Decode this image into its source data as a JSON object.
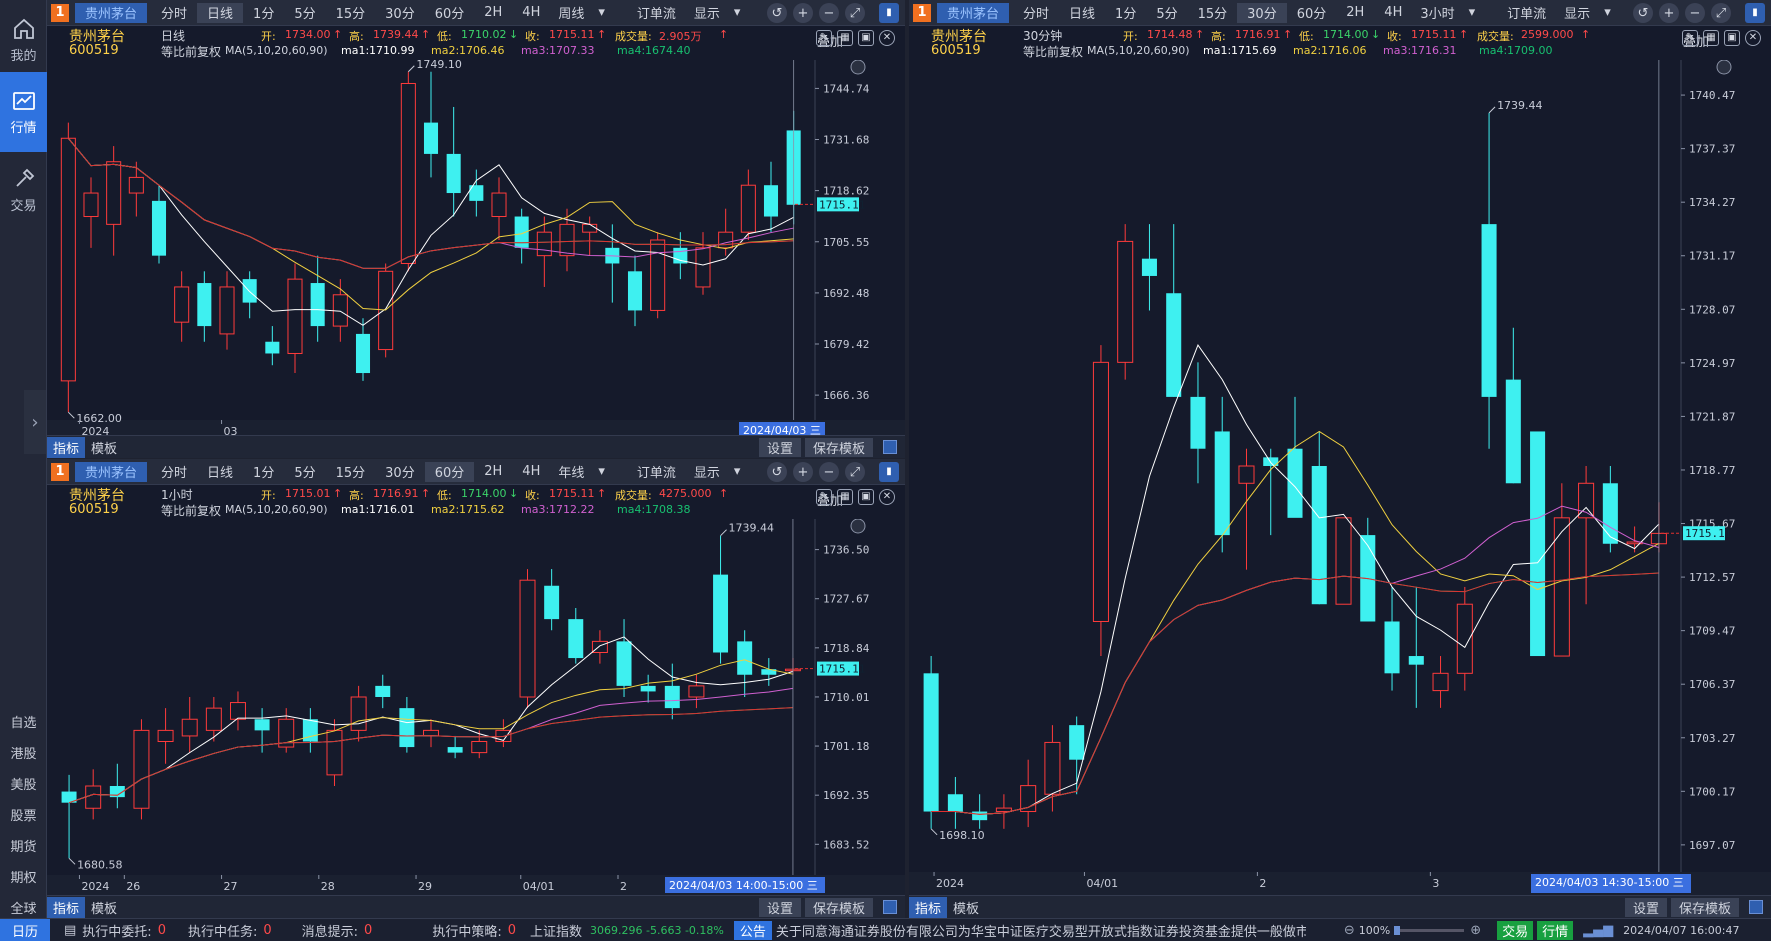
{
  "sidebar": {
    "nav": [
      {
        "label": "我的",
        "icon": "home-icon"
      },
      {
        "label": "行情",
        "icon": "chart-icon",
        "active": true
      },
      {
        "label": "交易",
        "icon": "trade-icon"
      }
    ],
    "markets": [
      "自选",
      "港股",
      "美股",
      "股票",
      "期货",
      "期权",
      "全球"
    ]
  },
  "panels": {
    "daily": {
      "number": "1",
      "stock_name": "贵州茅台",
      "stock_code": "600519",
      "tabs": [
        "分时",
        "日线",
        "1分",
        "5分",
        "15分",
        "30分",
        "60分",
        "2H",
        "4H"
      ],
      "selected_tab": "日线",
      "period_dropdown": "周线",
      "order_flow": "订单流",
      "display": "显示",
      "period_label": "日线",
      "adjust_label": "等比前复权",
      "quote": {
        "open_label": "开:",
        "open": "1734.00",
        "high_label": "高:",
        "high": "1739.44",
        "low_label": "低:",
        "low": "1710.02",
        "close_label": "收:",
        "close": "1715.11",
        "vol_label": "成交量:",
        "vol": "2.905万"
      },
      "ma": {
        "params": "MA(5,10,20,60,90)",
        "ma1": "1710.99",
        "ma2": "1706.46",
        "ma3": "1707.33",
        "ma4": "1674.40"
      },
      "overlay": "叠加",
      "x_labels": [
        "2024",
        "03"
      ],
      "date_tag": "2024/04/03 三",
      "bottom_tabs": [
        "指标",
        "模板"
      ],
      "settings": "设置",
      "save_template": "保存模板"
    },
    "hourly": {
      "number": "1",
      "stock_name": "贵州茅台",
      "stock_code": "600519",
      "tabs": [
        "分时",
        "日线",
        "1分",
        "5分",
        "15分",
        "30分",
        "60分",
        "2H",
        "4H"
      ],
      "selected_tab": "60分",
      "period_dropdown": "年线",
      "order_flow": "订单流",
      "display": "显示",
      "period_label": "1小时",
      "adjust_label": "等比前复权",
      "quote": {
        "open_label": "开:",
        "open": "1715.01",
        "high_label": "高:",
        "high": "1716.91",
        "low_label": "低:",
        "low": "1714.00",
        "close_label": "收:",
        "close": "1715.11",
        "vol_label": "成交量:",
        "vol": "4275.000"
      },
      "ma": {
        "params": "MA(5,10,20,60,90)",
        "ma1": "1716.01",
        "ma2": "1715.62",
        "ma3": "1712.22",
        "ma4": "1708.38"
      },
      "overlay": "叠加",
      "x_labels": [
        "2024",
        "26",
        "27",
        "28",
        "29",
        "04/01",
        "2"
      ],
      "date_tag": "2024/04/03 14:00-15:00 三",
      "bottom_tabs": [
        "指标",
        "模板"
      ],
      "settings": "设置",
      "save_template": "保存模板"
    },
    "min30": {
      "number": "1",
      "stock_name": "贵州茅台",
      "stock_code": "600519",
      "tabs": [
        "分时",
        "日线",
        "1分",
        "5分",
        "15分",
        "30分",
        "60分",
        "2H",
        "4H"
      ],
      "selected_tab": "30分",
      "period_dropdown": "3小时",
      "order_flow": "订单流",
      "display": "显示",
      "period_label": "30分钟",
      "adjust_label": "等比前复权",
      "quote": {
        "open_label": "开:",
        "open": "1714.48",
        "high_label": "高:",
        "high": "1716.91",
        "low_label": "低:",
        "low": "1714.00",
        "close_label": "收:",
        "close": "1715.11",
        "vol_label": "成交量:",
        "vol": "2599.000"
      },
      "ma": {
        "params": "MA(5,10,20,60,90)",
        "ma1": "1715.69",
        "ma2": "1716.06",
        "ma3": "1716.31",
        "ma4": "1709.00"
      },
      "overlay": "叠加",
      "x_labels": [
        "2024",
        "04/01",
        "2",
        "3"
      ],
      "date_tag": "2024/04/03 14:30-15:00 三",
      "bottom_tabs": [
        "指标",
        "模板"
      ],
      "settings": "设置",
      "save_template": "保存模板"
    }
  },
  "chart_data": [
    {
      "type": "candlestick",
      "title": "贵州茅台 日线",
      "y_ticks": [
        "1744.74",
        "1731.68",
        "1718.62",
        "1705.55",
        "1692.48",
        "1679.42",
        "1666.36"
      ],
      "ylim": [
        1660,
        1752
      ],
      "last_price": "1715.11",
      "annotations": {
        "high": "1749.10",
        "low": "1662.00"
      },
      "candles": [
        {
          "o": 1670,
          "h": 1736,
          "l": 1662,
          "c": 1732
        },
        {
          "o": 1712,
          "h": 1722,
          "l": 1704,
          "c": 1718
        },
        {
          "o": 1710,
          "h": 1730,
          "l": 1702,
          "c": 1726
        },
        {
          "o": 1718,
          "h": 1726,
          "l": 1712,
          "c": 1722
        },
        {
          "o": 1716,
          "h": 1720,
          "l": 1700,
          "c": 1702
        },
        {
          "o": 1685,
          "h": 1698,
          "l": 1680,
          "c": 1694
        },
        {
          "o": 1695,
          "h": 1698,
          "l": 1680,
          "c": 1684
        },
        {
          "o": 1682,
          "h": 1698,
          "l": 1678,
          "c": 1694
        },
        {
          "o": 1696,
          "h": 1698,
          "l": 1686,
          "c": 1690
        },
        {
          "o": 1680,
          "h": 1684,
          "l": 1674,
          "c": 1677
        },
        {
          "o": 1677,
          "h": 1700,
          "l": 1672,
          "c": 1696
        },
        {
          "o": 1695,
          "h": 1702,
          "l": 1680,
          "c": 1684
        },
        {
          "o": 1684,
          "h": 1696,
          "l": 1680,
          "c": 1692
        },
        {
          "o": 1682,
          "h": 1686,
          "l": 1670,
          "c": 1672
        },
        {
          "o": 1678,
          "h": 1700,
          "l": 1676,
          "c": 1698
        },
        {
          "o": 1700,
          "h": 1749,
          "l": 1698,
          "c": 1746
        },
        {
          "o": 1736,
          "h": 1749,
          "l": 1722,
          "c": 1728
        },
        {
          "o": 1728,
          "h": 1740,
          "l": 1712,
          "c": 1718
        },
        {
          "o": 1720,
          "h": 1724,
          "l": 1712,
          "c": 1716
        },
        {
          "o": 1712,
          "h": 1722,
          "l": 1706,
          "c": 1718
        },
        {
          "o": 1712,
          "h": 1714,
          "l": 1700,
          "c": 1704
        },
        {
          "o": 1702,
          "h": 1712,
          "l": 1694,
          "c": 1708
        },
        {
          "o": 1702,
          "h": 1714,
          "l": 1698,
          "c": 1710
        },
        {
          "o": 1708,
          "h": 1712,
          "l": 1702,
          "c": 1710
        },
        {
          "o": 1704,
          "h": 1710,
          "l": 1690,
          "c": 1700
        },
        {
          "o": 1698,
          "h": 1702,
          "l": 1684,
          "c": 1688
        },
        {
          "o": 1688,
          "h": 1708,
          "l": 1686,
          "c": 1706
        },
        {
          "o": 1704,
          "h": 1708,
          "l": 1696,
          "c": 1700
        },
        {
          "o": 1694,
          "h": 1708,
          "l": 1692,
          "c": 1704
        },
        {
          "o": 1704,
          "h": 1714,
          "l": 1702,
          "c": 1708
        },
        {
          "o": 1708,
          "h": 1724,
          "l": 1706,
          "c": 1720
        },
        {
          "o": 1720,
          "h": 1726,
          "l": 1708,
          "c": 1712
        },
        {
          "o": 1734,
          "h": 1739,
          "l": 1710,
          "c": 1715
        }
      ]
    },
    {
      "type": "candlestick",
      "title": "贵州茅台 1小时",
      "y_ticks": [
        "1736.50",
        "1727.67",
        "1718.84",
        "1710.01",
        "1701.18",
        "1692.35",
        "1683.52"
      ],
      "ylim": [
        1678,
        1742
      ],
      "last_price": "1715.11",
      "annotations": {
        "high": "1739.44",
        "low": "1680.58"
      },
      "candles": [
        {
          "o": 1693,
          "h": 1696,
          "l": 1681,
          "c": 1691
        },
        {
          "o": 1690,
          "h": 1697,
          "l": 1688,
          "c": 1694
        },
        {
          "o": 1694,
          "h": 1698,
          "l": 1690,
          "c": 1692
        },
        {
          "o": 1690,
          "h": 1706,
          "l": 1688,
          "c": 1704
        },
        {
          "o": 1702,
          "h": 1708,
          "l": 1698,
          "c": 1704
        },
        {
          "o": 1703,
          "h": 1710,
          "l": 1700,
          "c": 1706
        },
        {
          "o": 1704,
          "h": 1710,
          "l": 1702,
          "c": 1708
        },
        {
          "o": 1706,
          "h": 1711,
          "l": 1704,
          "c": 1709
        },
        {
          "o": 1706,
          "h": 1708,
          "l": 1700,
          "c": 1704
        },
        {
          "o": 1701,
          "h": 1708,
          "l": 1700,
          "c": 1706
        },
        {
          "o": 1706,
          "h": 1708,
          "l": 1700,
          "c": 1702
        },
        {
          "o": 1696,
          "h": 1706,
          "l": 1694,
          "c": 1704
        },
        {
          "o": 1704,
          "h": 1712,
          "l": 1702,
          "c": 1710
        },
        {
          "o": 1712,
          "h": 1714,
          "l": 1708,
          "c": 1710
        },
        {
          "o": 1708,
          "h": 1710,
          "l": 1700,
          "c": 1701
        },
        {
          "o": 1703,
          "h": 1706,
          "l": 1701,
          "c": 1704
        },
        {
          "o": 1701,
          "h": 1703,
          "l": 1699,
          "c": 1700
        },
        {
          "o": 1700,
          "h": 1704,
          "l": 1699,
          "c": 1702
        },
        {
          "o": 1702,
          "h": 1706,
          "l": 1701,
          "c": 1704
        },
        {
          "o": 1710,
          "h": 1733,
          "l": 1708,
          "c": 1731
        },
        {
          "o": 1730,
          "h": 1733,
          "l": 1722,
          "c": 1724
        },
        {
          "o": 1724,
          "h": 1726,
          "l": 1716,
          "c": 1717
        },
        {
          "o": 1718,
          "h": 1722,
          "l": 1716,
          "c": 1720
        },
        {
          "o": 1720,
          "h": 1724,
          "l": 1710,
          "c": 1712
        },
        {
          "o": 1712,
          "h": 1714,
          "l": 1709,
          "c": 1711
        },
        {
          "o": 1712,
          "h": 1716,
          "l": 1706,
          "c": 1708
        },
        {
          "o": 1710,
          "h": 1714,
          "l": 1708,
          "c": 1712
        },
        {
          "o": 1732,
          "h": 1739,
          "l": 1716,
          "c": 1718
        },
        {
          "o": 1720,
          "h": 1722,
          "l": 1710,
          "c": 1714
        },
        {
          "o": 1715,
          "h": 1717,
          "l": 1712,
          "c": 1714
        },
        {
          "o": 1715,
          "h": 1717,
          "l": 1714,
          "c": 1715
        }
      ]
    },
    {
      "type": "candlestick",
      "title": "贵州茅台 30分钟",
      "y_ticks": [
        "1740.47",
        "1737.37",
        "1734.27",
        "1731.17",
        "1728.07",
        "1724.97",
        "1721.87",
        "1718.77",
        "1715.67",
        "1712.57",
        "1709.47",
        "1706.37",
        "1703.27",
        "1700.17",
        "1697.07"
      ],
      "ylim": [
        1695.5,
        1742.5
      ],
      "last_price": "1715.11",
      "annotations": {
        "high": "1739.44",
        "low": "1698.10"
      },
      "candles": [
        {
          "o": 1707,
          "h": 1708,
          "l": 1698,
          "c": 1699
        },
        {
          "o": 1700,
          "h": 1701,
          "l": 1698,
          "c": 1699
        },
        {
          "o": 1699,
          "h": 1700,
          "l": 1698,
          "c": 1698.5
        },
        {
          "o": 1699,
          "h": 1700,
          "l": 1698,
          "c": 1699.2
        },
        {
          "o": 1699,
          "h": 1702,
          "l": 1698.1,
          "c": 1700.5
        },
        {
          "o": 1700,
          "h": 1704,
          "l": 1699,
          "c": 1703
        },
        {
          "o": 1704,
          "h": 1704.5,
          "l": 1700,
          "c": 1702
        },
        {
          "o": 1710,
          "h": 1726,
          "l": 1708,
          "c": 1725
        },
        {
          "o": 1725,
          "h": 1733,
          "l": 1724,
          "c": 1732
        },
        {
          "o": 1731,
          "h": 1733,
          "l": 1728,
          "c": 1730
        },
        {
          "o": 1729,
          "h": 1733,
          "l": 1723,
          "c": 1723
        },
        {
          "o": 1723,
          "h": 1725,
          "l": 1718,
          "c": 1720
        },
        {
          "o": 1721,
          "h": 1723,
          "l": 1714,
          "c": 1715
        },
        {
          "o": 1718,
          "h": 1720,
          "l": 1713,
          "c": 1719
        },
        {
          "o": 1719.5,
          "h": 1720,
          "l": 1715,
          "c": 1719
        },
        {
          "o": 1720,
          "h": 1723,
          "l": 1718,
          "c": 1716
        },
        {
          "o": 1719,
          "h": 1721,
          "l": 1711,
          "c": 1711
        },
        {
          "o": 1711,
          "h": 1716,
          "l": 1711,
          "c": 1716
        },
        {
          "o": 1715,
          "h": 1716,
          "l": 1710,
          "c": 1710
        },
        {
          "o": 1710,
          "h": 1712,
          "l": 1706,
          "c": 1707
        },
        {
          "o": 1708,
          "h": 1712,
          "l": 1705,
          "c": 1707.5
        },
        {
          "o": 1706,
          "h": 1708,
          "l": 1705,
          "c": 1707
        },
        {
          "o": 1707,
          "h": 1712,
          "l": 1706,
          "c": 1711
        },
        {
          "o": 1733,
          "h": 1739.44,
          "l": 1720,
          "c": 1723
        },
        {
          "o": 1724,
          "h": 1727,
          "l": 1718,
          "c": 1718
        },
        {
          "o": 1721,
          "h": 1721,
          "l": 1708,
          "c": 1708
        },
        {
          "o": 1708,
          "h": 1718,
          "l": 1708,
          "c": 1716
        },
        {
          "o": 1716,
          "h": 1719,
          "l": 1711,
          "c": 1718
        },
        {
          "o": 1718,
          "h": 1719,
          "l": 1714,
          "c": 1714.5
        },
        {
          "o": 1714.5,
          "h": 1715.5,
          "l": 1714,
          "c": 1714.6
        },
        {
          "o": 1714.5,
          "h": 1716.9,
          "l": 1714,
          "c": 1715.1
        }
      ]
    }
  ],
  "status_bar": {
    "calendar": "日历",
    "pending_orders_label": "执行中委托:",
    "pending_orders": "0",
    "pending_tasks_label": "执行中任务:",
    "pending_tasks": "0",
    "messages_label": "消息提示:",
    "messages": "0",
    "strategies_label": "执行中策略:",
    "strategies": "0",
    "index_name": "上证指数",
    "index_value": "3069.296  -5.663  -0.18%",
    "announcement_tag": "公告",
    "announcement": "关于同意海通证券股份有限公司为华宝中证医疗交易型开放式指数证券投资基金提供一般做市服务的公告",
    "zoom": "100%",
    "trade": "交易",
    "quotes": "行情",
    "clock": "2024/04/07 16:00:47"
  },
  "colors": {
    "up": "#ff3b3b",
    "down": "#3ef0f0",
    "ma1": "#ffffff",
    "ma2": "#f0d040",
    "ma3": "#d060d0",
    "ma4": "#18c070",
    "ma5": "#e03030"
  }
}
